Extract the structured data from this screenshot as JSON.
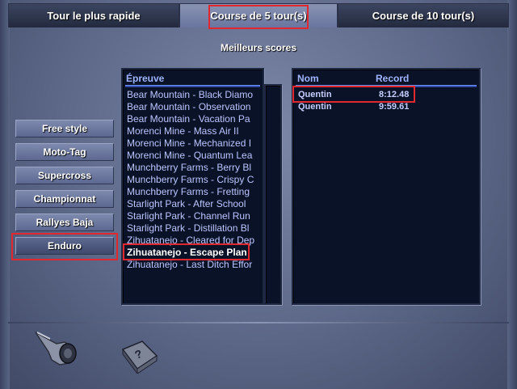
{
  "tabs": [
    {
      "label": "Tour le plus rapide"
    },
    {
      "label": "Course de 5 tour(s)"
    },
    {
      "label": "Course de 10 tour(s)"
    }
  ],
  "heading": "Meilleurs scores",
  "modes": [
    {
      "label": "Free style"
    },
    {
      "label": "Moto-Tag"
    },
    {
      "label": "Supercross"
    },
    {
      "label": "Championnat"
    },
    {
      "label": "Rallyes Baja"
    },
    {
      "label": "Enduro"
    }
  ],
  "selected_mode": "Enduro",
  "track_list": {
    "header": "Épreuve",
    "items": [
      "Bear Mountain - Black Diamo",
      "Bear Mountain - Observation",
      "Bear Mountain - Vacation Pa",
      "Morenci Mine - Mass Air II",
      "Morenci Mine - Mechanized I",
      "Morenci Mine - Quantum Lea",
      "Munchberry Farms - Berry Bl",
      "Munchberry Farms - Crispy C",
      "Munchberry Farms - Fretting",
      "Starlight Park - After School",
      "Starlight Park - Channel Run",
      "Starlight Park - Distillation Bl",
      "Zihuatanejo - Cleared for Dep",
      "Zihuatanejo - Escape Plan",
      "Zihuatanejo - Last Ditch Effor"
    ],
    "selected": "Zihuatanejo - Escape Plan"
  },
  "scores": {
    "header_name": "Nom",
    "header_record": "Record",
    "rows": [
      {
        "name": "Quentin",
        "record": "8:12.48"
      },
      {
        "name": "Quentin",
        "record": "9:59.61"
      }
    ]
  },
  "icons": {
    "back": "pointing-hand-icon",
    "help": "help-book-icon"
  },
  "colors": {
    "highlight_box": "#e0282e",
    "list_text": "#bcc6ff",
    "header_text": "#9fb4ff"
  }
}
